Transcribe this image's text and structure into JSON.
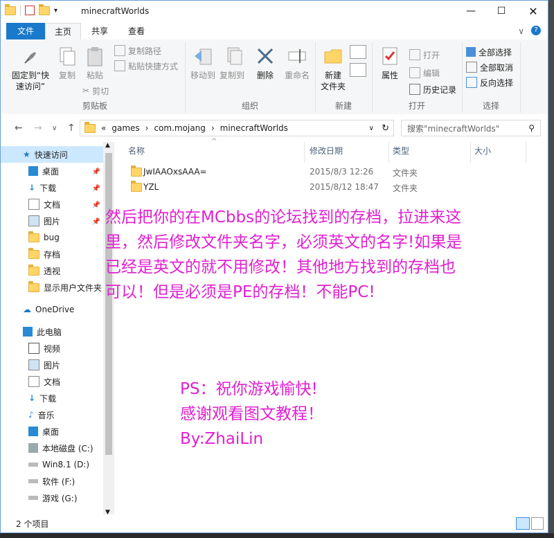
{
  "window": {
    "title": "minecraftWorlds"
  },
  "ribbon_tabs": [
    "文件",
    "主页",
    "共享",
    "查看"
  ],
  "clipboard": {
    "pin": "固定到“快速访问”",
    "copy": "复制",
    "paste": "粘贴",
    "copy_path": "复制路径",
    "paste_shortcut": "粘贴快捷方式",
    "cut": "剪切",
    "label": "剪贴板"
  },
  "organize": {
    "move_to": "移动到",
    "copy_to": "复制到",
    "delete": "删除",
    "rename": "重命名",
    "label": "组织"
  },
  "new": {
    "new_folder": "新建\n文件夹",
    "label": "新建"
  },
  "open": {
    "properties": "属性",
    "open": "打开",
    "edit": "编辑",
    "history": "历史记录",
    "label": "打开"
  },
  "select": {
    "select_all": "全部选择",
    "select_none": "全部取消",
    "invert": "反向选择",
    "label": "选择"
  },
  "address": {
    "prefix": "«",
    "crumbs": [
      "games",
      "com.mojang",
      "minecraftWorlds"
    ],
    "search_placeholder": "搜索\"minecraftWorlds\""
  },
  "nav": {
    "quick_access": "快速访问",
    "items": [
      "桌面",
      "下载",
      "文档",
      "图片",
      "bug",
      "存档",
      "透视",
      "显示用户文件夹"
    ],
    "onedrive": "OneDrive",
    "this_pc": "此电脑",
    "pc_items": [
      "视频",
      "图片",
      "文档",
      "下载",
      "音乐",
      "桌面",
      "本地磁盘 (C:)",
      "Win8.1 (D:)",
      "软件 (F:)",
      "游戏 (G:)"
    ]
  },
  "columns": {
    "name": "名称",
    "date": "修改日期",
    "type": "类型",
    "size": "大小"
  },
  "files": [
    {
      "name": "JwIAAOxsAAA=",
      "date": "2015/8/3 12:26",
      "type": "文件夹"
    },
    {
      "name": "YZL",
      "date": "2015/8/12 18:47",
      "type": "文件夹"
    }
  ],
  "status": {
    "count": "2 个项目"
  },
  "overlay": {
    "lines": [
      "然后把你的在MCbbs的论坛找到的存档，拉进来这",
      "里，然后修改文件夹名字，必须英文的名字!如果是",
      "已经是英文的就不用修改！其他地方找到的存档也",
      "可以！但是必须是PE的存档！不能PC!"
    ],
    "ps_lines": [
      "PS：祝你游戏愉快!",
      "感谢观看图文教程！",
      "By:ZhaiLin"
    ]
  },
  "colors": {
    "accent": "#1979ca",
    "overlay_text": "#e020d0",
    "folder": "#ffd568"
  }
}
